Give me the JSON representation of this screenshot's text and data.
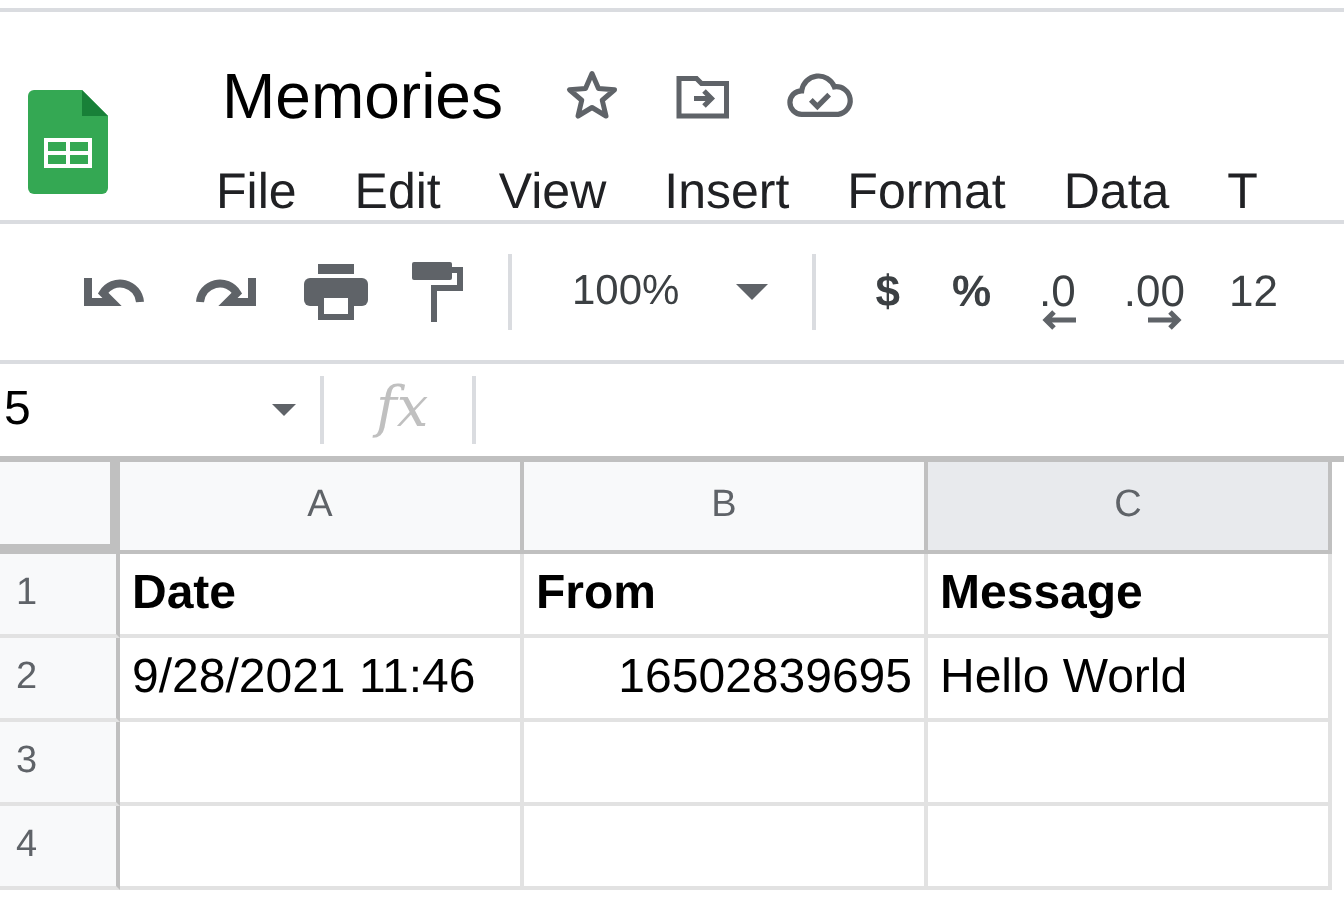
{
  "document": {
    "title": "Memories"
  },
  "menu": [
    "File",
    "Edit",
    "View",
    "Insert",
    "Format",
    "Data",
    "T"
  ],
  "toolbar": {
    "zoom": "100%",
    "currency": "$",
    "percent": "%",
    "decrease_decimals": ".0",
    "increase_decimals": ".00",
    "more_formats": "12"
  },
  "formula_bar": {
    "name_box": "5",
    "fx": "fx"
  },
  "columns": [
    {
      "label": "A",
      "selected": false
    },
    {
      "label": "B",
      "selected": false
    },
    {
      "label": "C",
      "selected": true
    }
  ],
  "rows": [
    {
      "number": "1",
      "cells": [
        {
          "text": "Date",
          "kind": "text",
          "bold": true
        },
        {
          "text": "From",
          "kind": "text",
          "bold": true
        },
        {
          "text": "Message",
          "kind": "text",
          "bold": true
        }
      ]
    },
    {
      "number": "2",
      "cells": [
        {
          "text": "9/28/2021 11:46",
          "kind": "text",
          "bold": false
        },
        {
          "text": "16502839695",
          "kind": "number",
          "bold": false
        },
        {
          "text": "Hello World",
          "kind": "text",
          "bold": false
        }
      ]
    },
    {
      "number": "3",
      "cells": []
    },
    {
      "number": "4",
      "cells": []
    }
  ]
}
